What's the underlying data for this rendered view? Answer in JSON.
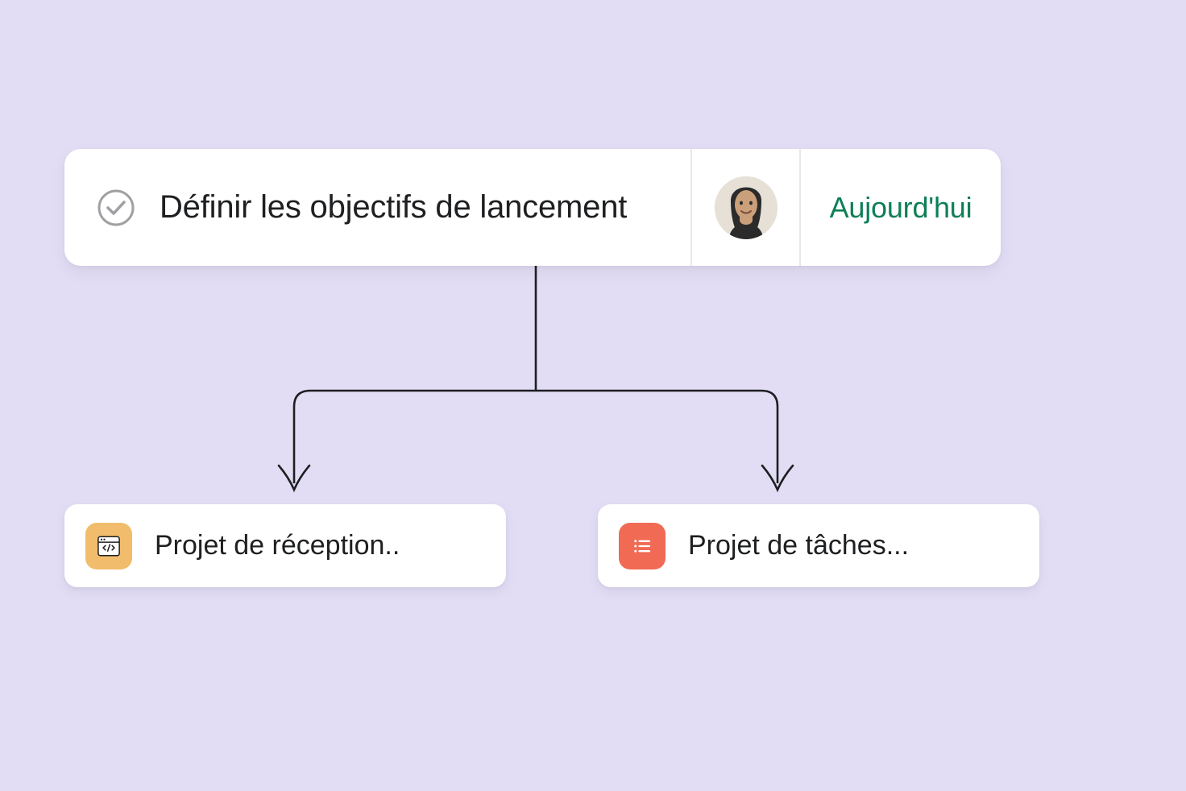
{
  "task": {
    "title": "Définir les objectifs de lancement",
    "due_label": "Aujourd'hui",
    "due_color": "#0d7f56",
    "completed": false
  },
  "projects": [
    {
      "label": "Projet de réception..",
      "icon": "code-window-icon",
      "icon_bg": "#f1bd6c"
    },
    {
      "label": "Projet de tâches...",
      "icon": "list-icon",
      "icon_bg": "#f06a54"
    }
  ],
  "colors": {
    "background": "#e2ddf5",
    "card": "#ffffff",
    "text": "#1e1f21"
  }
}
